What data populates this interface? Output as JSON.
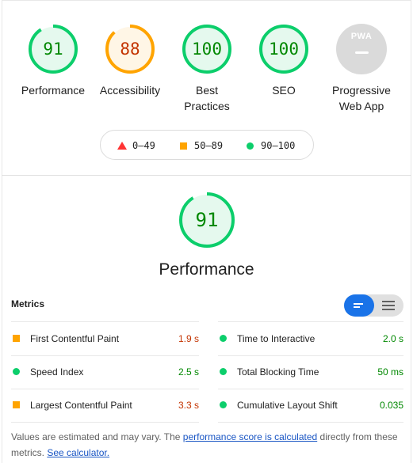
{
  "categories": [
    {
      "id": "performance",
      "score": "91",
      "label": "Performance",
      "status": "good",
      "fraction": 0.91
    },
    {
      "id": "accessibility",
      "score": "88",
      "label": "Accessibility",
      "status": "average",
      "fraction": 0.88
    },
    {
      "id": "best-practices",
      "score": "100",
      "label_line1": "Best",
      "label_line2": "Practices",
      "status": "good",
      "fraction": 1.0
    },
    {
      "id": "seo",
      "score": "100",
      "label": "SEO",
      "status": "good",
      "fraction": 1.0
    },
    {
      "id": "pwa",
      "badge_text": "PWA",
      "label_line1": "Progressive",
      "label_line2": "Web App"
    }
  ],
  "legend": {
    "fail": "0–49",
    "average": "50–89",
    "pass": "90–100"
  },
  "performance": {
    "score": "91",
    "fraction": 0.91,
    "title": "Performance"
  },
  "metrics": {
    "title": "Metrics",
    "items": [
      {
        "name": "First Contentful Paint",
        "value": "1.9 s",
        "status": "average"
      },
      {
        "name": "Time to Interactive",
        "value": "2.0 s",
        "status": "pass"
      },
      {
        "name": "Speed Index",
        "value": "2.5 s",
        "status": "pass"
      },
      {
        "name": "Total Blocking Time",
        "value": "50 ms",
        "status": "pass"
      },
      {
        "name": "Largest Contentful Paint",
        "value": "3.3 s",
        "status": "average"
      },
      {
        "name": "Cumulative Layout Shift",
        "value": "0.035",
        "status": "pass"
      }
    ]
  },
  "footnote": {
    "text1": "Values are estimated and may vary. The ",
    "link1": "performance score is calculated",
    "text2": " directly from these metrics. ",
    "link2": "See calculator."
  },
  "colors": {
    "pass": "#0cce6b",
    "pass_text": "#008800",
    "pass_bg": "#e5f9ee",
    "average": "#ffa400",
    "average_text": "#c33300",
    "average_bg": "#fff6e6",
    "fail": "#ff3333",
    "accent": "#1a73e8"
  }
}
